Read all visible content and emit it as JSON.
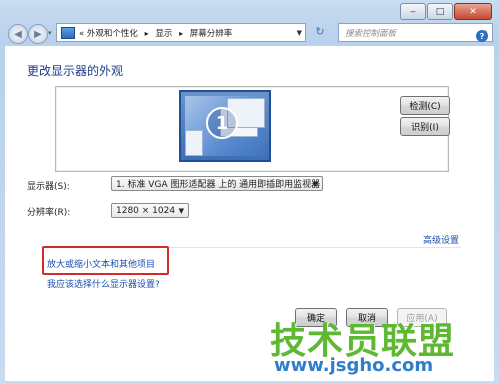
{
  "window": {
    "controls": [
      "‒",
      "□",
      "✕"
    ]
  },
  "addressbar": {
    "overflow": "«",
    "crumbs": [
      "外观和个性化",
      "显示",
      "屏幕分辨率"
    ],
    "separator": "▸",
    "search_placeholder": "搜索控制面板"
  },
  "page": {
    "title": "更改显示器的外观",
    "monitor_number": "1",
    "detect_label": "检测(C)",
    "identify_label": "识别(I)",
    "display_label": "显示器(S):",
    "display_value": "1. 标准 VGA 图形适配器 上的 通用即插即用监视器",
    "resolution_label": "分辨率(R):",
    "resolution_value": "1280 × 1024",
    "advanced_link": "高级设置",
    "link_text_size": "放大或缩小文本和其他项目",
    "link_which_settings": "我应该选择什么显示器设置?",
    "ok_label": "确定",
    "cancel_label": "取消",
    "apply_label": "应用(A)"
  },
  "watermark": {
    "brand": "技术员联盟",
    "url": "www.jsgho.com"
  },
  "icons": {
    "back": "back-arrow-icon",
    "forward": "forward-arrow-icon",
    "refresh": "refresh-icon",
    "search": "magnifier-icon",
    "help": "help-icon",
    "control_panel": "control-panel-icon"
  }
}
